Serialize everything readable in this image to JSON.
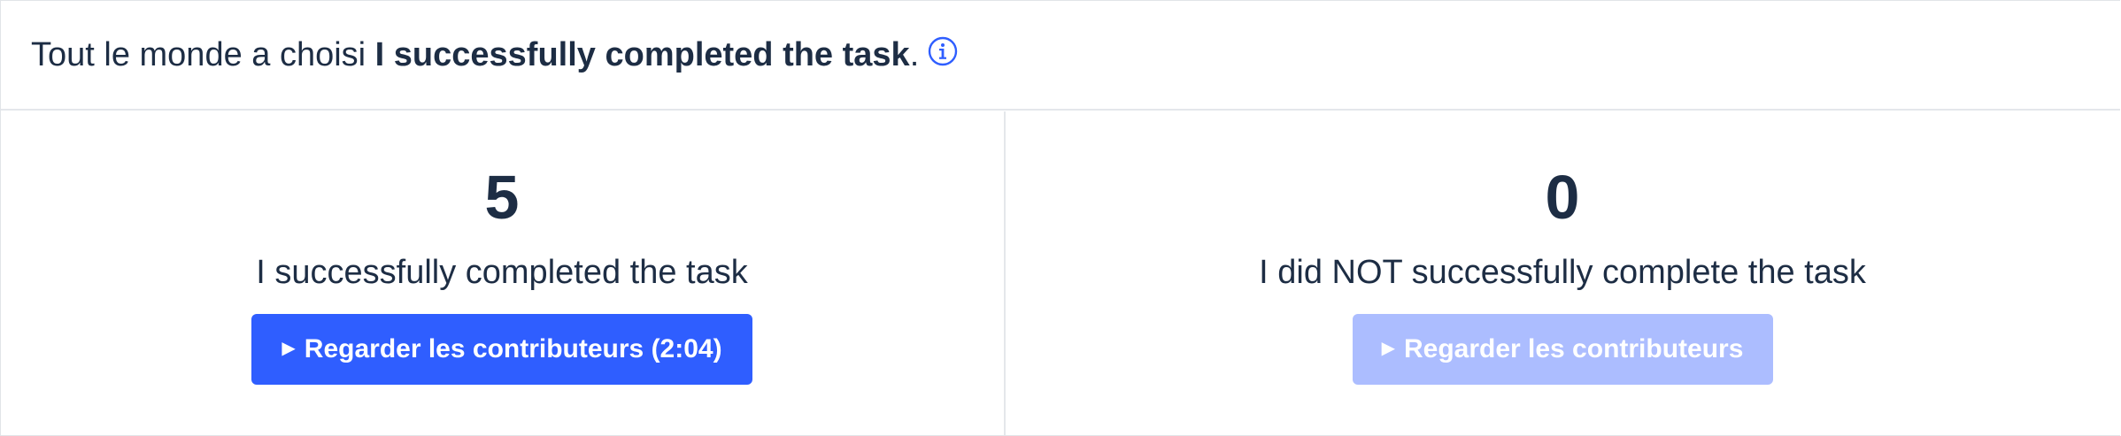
{
  "header": {
    "prefix": "Tout le monde a choisi ",
    "choice": "I successfully completed the task",
    "suffix": ".",
    "info_icon": "info-circle-icon"
  },
  "options": [
    {
      "count": "5",
      "label": "I successfully completed the task",
      "button_label": "Regarder les contributeurs (2:04)",
      "button_enabled": true
    },
    {
      "count": "0",
      "label": "I did NOT successfully complete the task",
      "button_label": "Regarder les contributeurs",
      "button_enabled": false
    }
  ],
  "colors": {
    "text": "#1d2d44",
    "accent": "#2f5eff",
    "accent_disabled": "#acbdff",
    "divider": "#e4e7eb"
  }
}
